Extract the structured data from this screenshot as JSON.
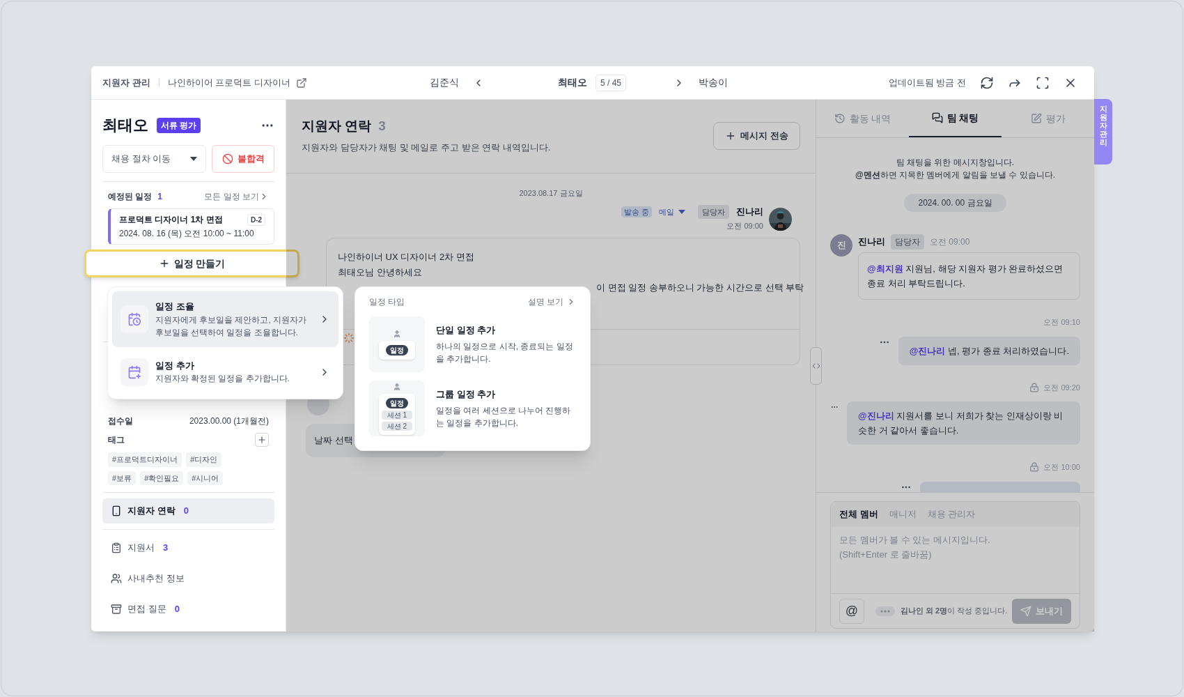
{
  "topbar": {
    "breadcrumb": [
      "지원자 관리",
      "나인하이어 프로덕트 디자이너"
    ],
    "prev_applicant": "김준식",
    "current_applicant": "최태오",
    "position": "5 / 45",
    "next_applicant": "박송이",
    "updated": "업데이트됨 방금 전"
  },
  "side_tab": "지원자 관리",
  "applicant": {
    "name": "최태오",
    "stage": "서류 평가",
    "stage_select": "채용 절차 이동",
    "reject_button": "불합격"
  },
  "schedule": {
    "title": "예정된 일정",
    "count": "1",
    "view_all": "모든 일정 보기",
    "events": [
      {
        "title": "프로덕트 디자이너 1차 면접",
        "dday": "D-2",
        "time": "2024. 08. 16 (목) 오전 10:00 ~ 11:00"
      }
    ]
  },
  "create_button": {
    "label": "일정 만들기",
    "highlighted": true
  },
  "create_menu": [
    {
      "kind": "coordinate",
      "title": "일정 조율",
      "description": "지원자에게 후보일을 제안하고, 지원자가 후보일을 선택하여 일정을 조율합니다.",
      "selected": true
    },
    {
      "kind": "add",
      "title": "일정 추가",
      "description": "지원자와 확정된 일정을 추가합니다.",
      "selected": false
    }
  ],
  "type_menu": {
    "title": "일정 타입",
    "help": "설명 보기",
    "options": [
      {
        "kind": "single",
        "title": "단일 일정 추가",
        "description": "하나의 일정으로 시작, 종료되는 일정을 추가합니다.",
        "badge": "일정"
      },
      {
        "kind": "group",
        "title": "그룹 일정 추가",
        "description": "일정을 여러 세션으로 나누어 진행하는 일정을 추가합니다.",
        "badge": "일정",
        "sessions": [
          "세션 1",
          "세션 2"
        ]
      }
    ]
  },
  "details": {
    "received_label": "접수일",
    "received_value": "2023.00.00 (1개월전)",
    "tags_label": "태그",
    "tags": [
      "#프로덕트디자이너",
      "#디자인",
      "#보류",
      "#확인필요",
      "#시니어"
    ]
  },
  "nav": [
    {
      "kind": "phone",
      "label": "지원자 연락",
      "count": "0",
      "selected": true
    },
    {
      "kind": "clipboard",
      "label": "지원서",
      "count": "3",
      "selected": false
    },
    {
      "kind": "people",
      "label": "사내추천 정보",
      "selected": false
    },
    {
      "kind": "tray",
      "label": "면접 질문",
      "count": "0",
      "selected": false
    }
  ],
  "contacts": {
    "title": "지원자 연락",
    "count": "3",
    "subtitle": "지원자와 담당자가 채팅 및 메일로 주고 받은 연락 내역입니다.",
    "send_button": "메시지 전송",
    "date": "2023.08.17 금요일",
    "mail": {
      "status": "발송 중",
      "channel": "메일",
      "role": "담당자",
      "sender": "진나리",
      "time": "오전 09:00",
      "lines": [
        "나인하이너 UX 디자이너 2차 면접",
        "최태오님 안녕하세요"
      ],
      "line_behind_popup": "이 면접 일정 송부하오니 가능한 시간으로 선택 부탁"
    },
    "reply": {
      "bubble": "날짜 선택"
    }
  },
  "team_chat": {
    "tabs": [
      {
        "kind": "history",
        "label": "활동 내역",
        "selected": false
      },
      {
        "kind": "chat",
        "label": "팀 채팅",
        "selected": true
      },
      {
        "kind": "edit",
        "label": "평가",
        "selected": false
      }
    ],
    "notice": [
      "팀 채팅을 위한 메시지창입니다.",
      "**@멘션**하면 지목한 멤버에게 알림을 보낼 수 있습니다."
    ],
    "date": "2024. 00. 00 금요일",
    "messages": [
      {
        "kind": "incoming",
        "avatar": "진",
        "sender": "진나리",
        "role": "담당자",
        "time": "오전 09:00",
        "text": "**@최지원** 지원님, 해당 지원자 평가 완료하셨으면 종료 처리 부탁드립니다."
      },
      {
        "kind": "outgoing",
        "time": "오전 09:10",
        "private": false,
        "text": "**@진나리** 넵, 평가 종료 처리하였습니다."
      },
      {
        "kind": "outgoing",
        "time": "오전 09:20",
        "private": true,
        "text": "**@진나리** 지원서를 보니 저희가 찾는 인재상이랑 비슷한 거 같아서 좋습니다."
      },
      {
        "kind": "outgoing",
        "time": "오전 10:00",
        "private": true
      }
    ]
  },
  "composer": {
    "tabs": [
      {
        "label": "전체 멤버",
        "selected": true
      },
      {
        "label": "매니저",
        "selected": false
      },
      {
        "label": "채용 관리자",
        "selected": false
      }
    ],
    "placeholder": "모든 멤버가 볼 수 있는 메시지입니다.\n(Shift+Enter 로 줄바꿈)",
    "mention_button": "@",
    "typing": "**김나인 외 2명**이 작성 중입니다.",
    "send_button": {
      "label": "보내기",
      "disabled": true
    }
  }
}
